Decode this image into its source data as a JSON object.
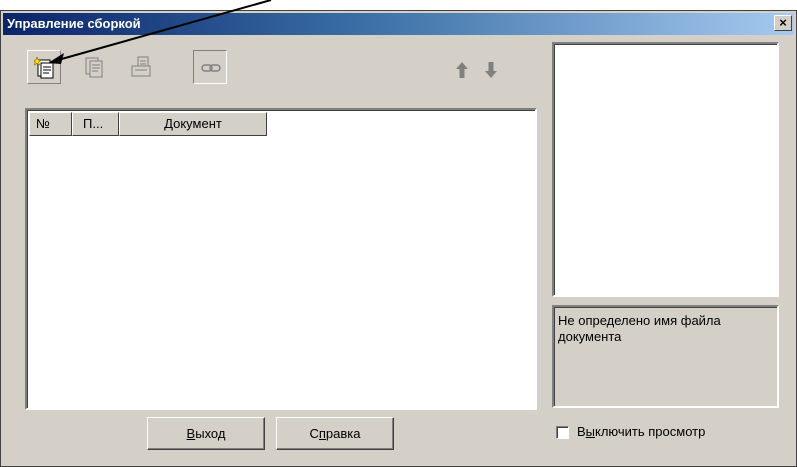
{
  "window": {
    "title": "Управление сборкой",
    "close_glyph": "×"
  },
  "toolbar": {
    "add_document": "add-document-icon",
    "copy_document": "copy-document-icon",
    "replace_document": "replace-document-icon",
    "link": "link-icon",
    "move_up": "arrow-up-icon",
    "move_down": "arrow-down-icon"
  },
  "list": {
    "columns": [
      "№",
      "П...",
      "Документ"
    ],
    "rows": []
  },
  "info": {
    "text": "Не определено имя файла документа"
  },
  "buttons": {
    "exit": {
      "accel": "В",
      "rest": "ыход"
    },
    "help": {
      "before": "С",
      "accel": "п",
      "rest": "равка"
    }
  },
  "disable_preview": {
    "before": "В",
    "accel": "ы",
    "rest": "ключить просмотр",
    "checked": false
  }
}
